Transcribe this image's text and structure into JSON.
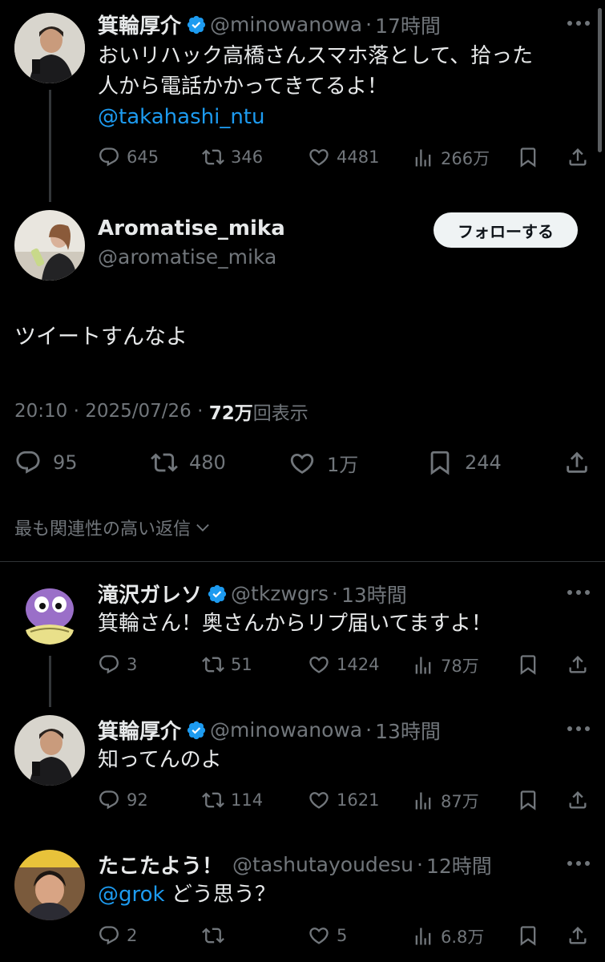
{
  "tweet1": {
    "name": "箕輪厚介",
    "handle": "@minowanowa",
    "time": "17時間",
    "line1": "おいリハック高橋さんスマホ落として、拾った",
    "line2": "人から電話かかってきてるよ！",
    "mention": "@takahashi_ntu",
    "replies": "645",
    "reposts": "346",
    "likes": "4481",
    "views": "266万"
  },
  "main": {
    "name": "Aromatise_mika",
    "handle": "@aromatise_mika",
    "follow_label": "フォローする",
    "text": "ツイートすんなよ",
    "time": "20:10",
    "date": "2025/07/26",
    "views_count": "72万",
    "views_label": "回表示",
    "replies": "95",
    "reposts": "480",
    "likes": "1万",
    "bookmarks": "244",
    "sort_label": "最も関連性の高い返信"
  },
  "reply1": {
    "name": "滝沢ガレソ",
    "handle": "@tkzwgrs",
    "time": "13時間",
    "text": "箕輪さん！奥さんからリプ届いてますよ！",
    "replies": "3",
    "reposts": "51",
    "likes": "1424",
    "views": "78万"
  },
  "reply2": {
    "name": "箕輪厚介",
    "handle": "@minowanowa",
    "time": "13時間",
    "text": "知ってんのよ",
    "replies": "92",
    "reposts": "114",
    "likes": "1621",
    "views": "87万"
  },
  "reply3": {
    "name": "たこたよう！",
    "handle": "@tashutayoudesu",
    "time": "12時間",
    "mention": "@grok",
    "text": " どう思う？",
    "replies": "2",
    "reposts": "",
    "likes": "5",
    "views": "6.8万"
  },
  "colors": {
    "background": "#000000",
    "text": "#e7e9ea",
    "muted": "#71767b",
    "link": "#1d9bf0",
    "verified": "#1d9bf0"
  },
  "sep": "·",
  "sep_spaced": " · "
}
